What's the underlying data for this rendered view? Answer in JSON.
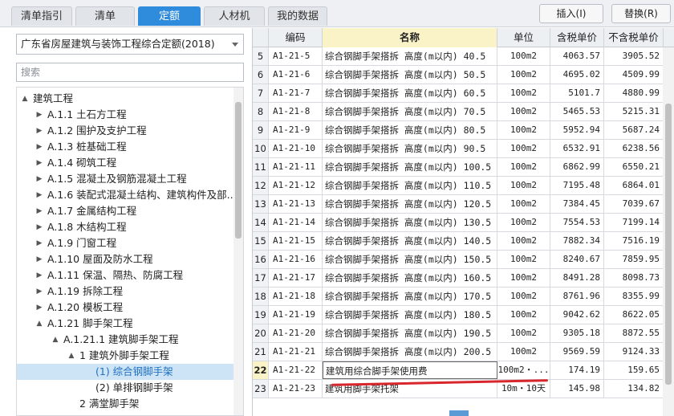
{
  "tabs": [
    {
      "label": "清单指引",
      "active": false
    },
    {
      "label": "清单",
      "active": false
    },
    {
      "label": "定额",
      "active": true
    },
    {
      "label": "人材机",
      "active": false
    },
    {
      "label": "我的数据",
      "active": false
    }
  ],
  "toolbar": {
    "insert_label": "插入(I)",
    "replace_label": "替换(R)"
  },
  "library": {
    "selected": "广东省房屋建筑与装饰工程综合定额(2018)"
  },
  "search": {
    "placeholder": "搜索"
  },
  "tree": [
    {
      "label": "建筑工程",
      "arrow": "▲"
    },
    {
      "label": "A.1.1 土石方工程",
      "arrow": "▶"
    },
    {
      "label": "A.1.2 围护及支护工程",
      "arrow": "▶"
    },
    {
      "label": "A.1.3 桩基础工程",
      "arrow": "▶"
    },
    {
      "label": "A.1.4 砌筑工程",
      "arrow": "▶"
    },
    {
      "label": "A.1.5 混凝土及钢筋混凝土工程",
      "arrow": "▶"
    },
    {
      "label": "A.1.6 装配式混凝土结构、建筑构件及部...",
      "arrow": "▶"
    },
    {
      "label": "A.1.7 金属结构工程",
      "arrow": "▶"
    },
    {
      "label": "A.1.8 木结构工程",
      "arrow": "▶"
    },
    {
      "label": "A.1.9 门窗工程",
      "arrow": "▶"
    },
    {
      "label": "A.1.10 屋面及防水工程",
      "arrow": "▶"
    },
    {
      "label": "A.1.11 保温、隔热、防腐工程",
      "arrow": "▶"
    },
    {
      "label": "A.1.19 拆除工程",
      "arrow": "▶"
    },
    {
      "label": "A.1.20 模板工程",
      "arrow": "▶"
    },
    {
      "label": "A.1.21 脚手架工程",
      "arrow": "▲"
    },
    {
      "label": "A.1.21.1 建筑脚手架工程",
      "arrow": "▲"
    },
    {
      "label": "1 建筑外脚手架工程",
      "arrow": "▲"
    },
    {
      "label": "(1) 综合钢脚手架",
      "arrow": ""
    },
    {
      "label": "(2) 单排钢脚手架",
      "arrow": ""
    },
    {
      "label": "2 满堂脚手架",
      "arrow": ""
    }
  ],
  "grid": {
    "headers": {
      "code": "编码",
      "name": "名称",
      "unit": "单位",
      "tax": "含税单价",
      "notax": "不含税单价"
    },
    "rows": [
      {
        "idx": "5",
        "code": "A1-21-5",
        "name": "综合钢脚手架搭拆 高度(m以内) 40.5",
        "unit": "100m2",
        "tax": "4063.57",
        "notax": "3905.52"
      },
      {
        "idx": "6",
        "code": "A1-21-6",
        "name": "综合钢脚手架搭拆 高度(m以内) 50.5",
        "unit": "100m2",
        "tax": "4695.02",
        "notax": "4509.99"
      },
      {
        "idx": "7",
        "code": "A1-21-7",
        "name": "综合钢脚手架搭拆 高度(m以内) 60.5",
        "unit": "100m2",
        "tax": "5101.7",
        "notax": "4880.99"
      },
      {
        "idx": "8",
        "code": "A1-21-8",
        "name": "综合钢脚手架搭拆 高度(m以内) 70.5",
        "unit": "100m2",
        "tax": "5465.53",
        "notax": "5215.31"
      },
      {
        "idx": "9",
        "code": "A1-21-9",
        "name": "综合钢脚手架搭拆 高度(m以内) 80.5",
        "unit": "100m2",
        "tax": "5952.94",
        "notax": "5687.24"
      },
      {
        "idx": "10",
        "code": "A1-21-10",
        "name": "综合钢脚手架搭拆 高度(m以内) 90.5",
        "unit": "100m2",
        "tax": "6532.91",
        "notax": "6238.56"
      },
      {
        "idx": "11",
        "code": "A1-21-11",
        "name": "综合钢脚手架搭拆 高度(m以内) 100.5",
        "unit": "100m2",
        "tax": "6862.99",
        "notax": "6550.21"
      },
      {
        "idx": "12",
        "code": "A1-21-12",
        "name": "综合钢脚手架搭拆 高度(m以内) 110.5",
        "unit": "100m2",
        "tax": "7195.48",
        "notax": "6864.01"
      },
      {
        "idx": "13",
        "code": "A1-21-13",
        "name": "综合钢脚手架搭拆 高度(m以内) 120.5",
        "unit": "100m2",
        "tax": "7384.45",
        "notax": "7039.67"
      },
      {
        "idx": "14",
        "code": "A1-21-14",
        "name": "综合钢脚手架搭拆 高度(m以内) 130.5",
        "unit": "100m2",
        "tax": "7554.53",
        "notax": "7199.14"
      },
      {
        "idx": "15",
        "code": "A1-21-15",
        "name": "综合钢脚手架搭拆 高度(m以内) 140.5",
        "unit": "100m2",
        "tax": "7882.34",
        "notax": "7516.19"
      },
      {
        "idx": "16",
        "code": "A1-21-16",
        "name": "综合钢脚手架搭拆 高度(m以内) 150.5",
        "unit": "100m2",
        "tax": "8240.67",
        "notax": "7859.95"
      },
      {
        "idx": "17",
        "code": "A1-21-17",
        "name": "综合钢脚手架搭拆 高度(m以内) 160.5",
        "unit": "100m2",
        "tax": "8491.28",
        "notax": "8098.73"
      },
      {
        "idx": "18",
        "code": "A1-21-18",
        "name": "综合钢脚手架搭拆 高度(m以内) 170.5",
        "unit": "100m2",
        "tax": "8761.96",
        "notax": "8355.99"
      },
      {
        "idx": "19",
        "code": "A1-21-19",
        "name": "综合钢脚手架搭拆 高度(m以内) 180.5",
        "unit": "100m2",
        "tax": "9042.62",
        "notax": "8622.05"
      },
      {
        "idx": "20",
        "code": "A1-21-20",
        "name": "综合钢脚手架搭拆 高度(m以内) 190.5",
        "unit": "100m2",
        "tax": "9305.18",
        "notax": "8872.55"
      },
      {
        "idx": "21",
        "code": "A1-21-21",
        "name": "综合钢脚手架搭拆 高度(m以内) 200.5",
        "unit": "100m2",
        "tax": "9569.59",
        "notax": "9124.33"
      },
      {
        "idx": "22",
        "code": "A1-21-22",
        "name": "建筑用综合脚手架使用费",
        "unit": "100m2・...",
        "tax": "174.19",
        "notax": "159.65"
      },
      {
        "idx": "23",
        "code": "A1-21-23",
        "name": "建筑用脚手架托架",
        "unit": "10m・10天",
        "tax": "145.98",
        "notax": "134.82"
      }
    ]
  },
  "colors": {
    "accent": "#2f8cdc",
    "highlight": "#fbf3c8",
    "annotation": "#d9262c",
    "selection": "#cde4f7"
  }
}
